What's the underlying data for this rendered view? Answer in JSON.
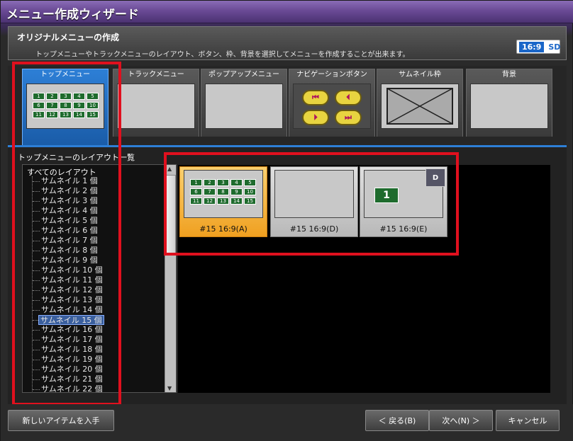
{
  "window": {
    "title": "メニュー作成ウィザード"
  },
  "header": {
    "title": "オリジナルメニューの作成",
    "description": "トップメニューやトラックメニューのレイアウト、ボタン、枠、背景を選択してメニューを作成することが出来ます。",
    "badge_ratio": "16:9",
    "badge_quality": "SD"
  },
  "tabs": [
    {
      "label": "トップメニュー"
    },
    {
      "label": "トラックメニュー"
    },
    {
      "label": "ポップアップメニュー"
    },
    {
      "label": "ナビゲーションボタン"
    },
    {
      "label": "サムネイル枠"
    },
    {
      "label": "背景"
    }
  ],
  "thumb_grid": [
    "1",
    "2",
    "3",
    "4",
    "5",
    "6",
    "7",
    "8",
    "9",
    "10",
    "11",
    "12",
    "13",
    "14",
    "15"
  ],
  "nav_buttons": [
    "⏮",
    "⏴",
    "⏵",
    "⏭"
  ],
  "layout_list": {
    "title": "トップメニューのレイアウト一覧",
    "root": "すべてのレイアウト",
    "items": [
      "サムネイル 1 個",
      "サムネイル 2 個",
      "サムネイル 3 個",
      "サムネイル 4 個",
      "サムネイル 5 個",
      "サムネイル 6 個",
      "サムネイル 7 個",
      "サムネイル 8 個",
      "サムネイル 9 個",
      "サムネイル 10 個",
      "サムネイル 11 個",
      "サムネイル 12 個",
      "サムネイル 13 個",
      "サムネイル 14 個",
      "サムネイル 15 個",
      "サムネイル 16 個",
      "サムネイル 17 個",
      "サムネイル 18 個",
      "サムネイル 19 個",
      "サムネイル 20 個",
      "サムネイル 21 個",
      "サムネイル 22 個"
    ],
    "selected_index": 14
  },
  "gallery": [
    {
      "label": "#15 16:9(A)"
    },
    {
      "label": "#15 16:9(D)"
    },
    {
      "label": "#15 16:9(E)",
      "badge": "D",
      "big_number": "1"
    }
  ],
  "footer": {
    "get_items": "新しいアイテムを入手",
    "back": "＜ 戻る(B)",
    "next": "次へ(N) ＞",
    "cancel": "キャンセル"
  },
  "colors": {
    "accent": "#2d7fd6",
    "highlight": "#e0101e",
    "selected_card": "#f0a020"
  }
}
